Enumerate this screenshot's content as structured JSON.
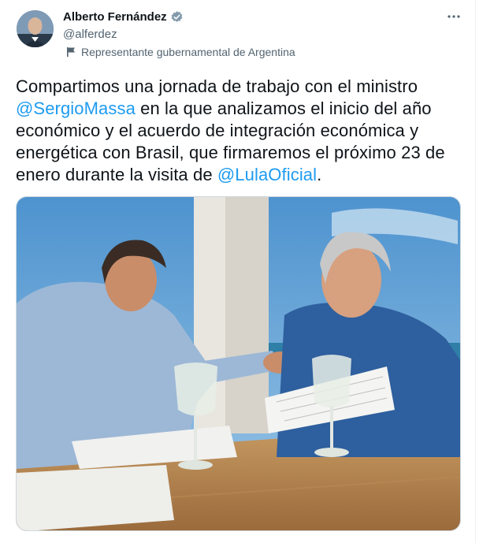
{
  "tweet": {
    "author_name": "Alberto Fernández",
    "author_handle": "@alferdez",
    "label": "Representante gubernamental de Argentina",
    "text_parts": {
      "p1": "Compartimos una jornada de trabajo con el ministro ",
      "mention1": "@SergioMassa",
      "p2": " en la que analizamos el inicio del año económico y el acuerdo de integración económica y energética con Brasil, que firmaremos el próximo 23 de enero durante la visita de ",
      "mention2": "@LulaOficial",
      "p3": "."
    }
  },
  "icons": {
    "verified": "verified-badge-icon",
    "more": "more-options-icon",
    "label": "flag-icon"
  },
  "colors": {
    "link": "#1d9bf0",
    "secondary_text": "#536471",
    "primary_text": "#0f1419"
  }
}
